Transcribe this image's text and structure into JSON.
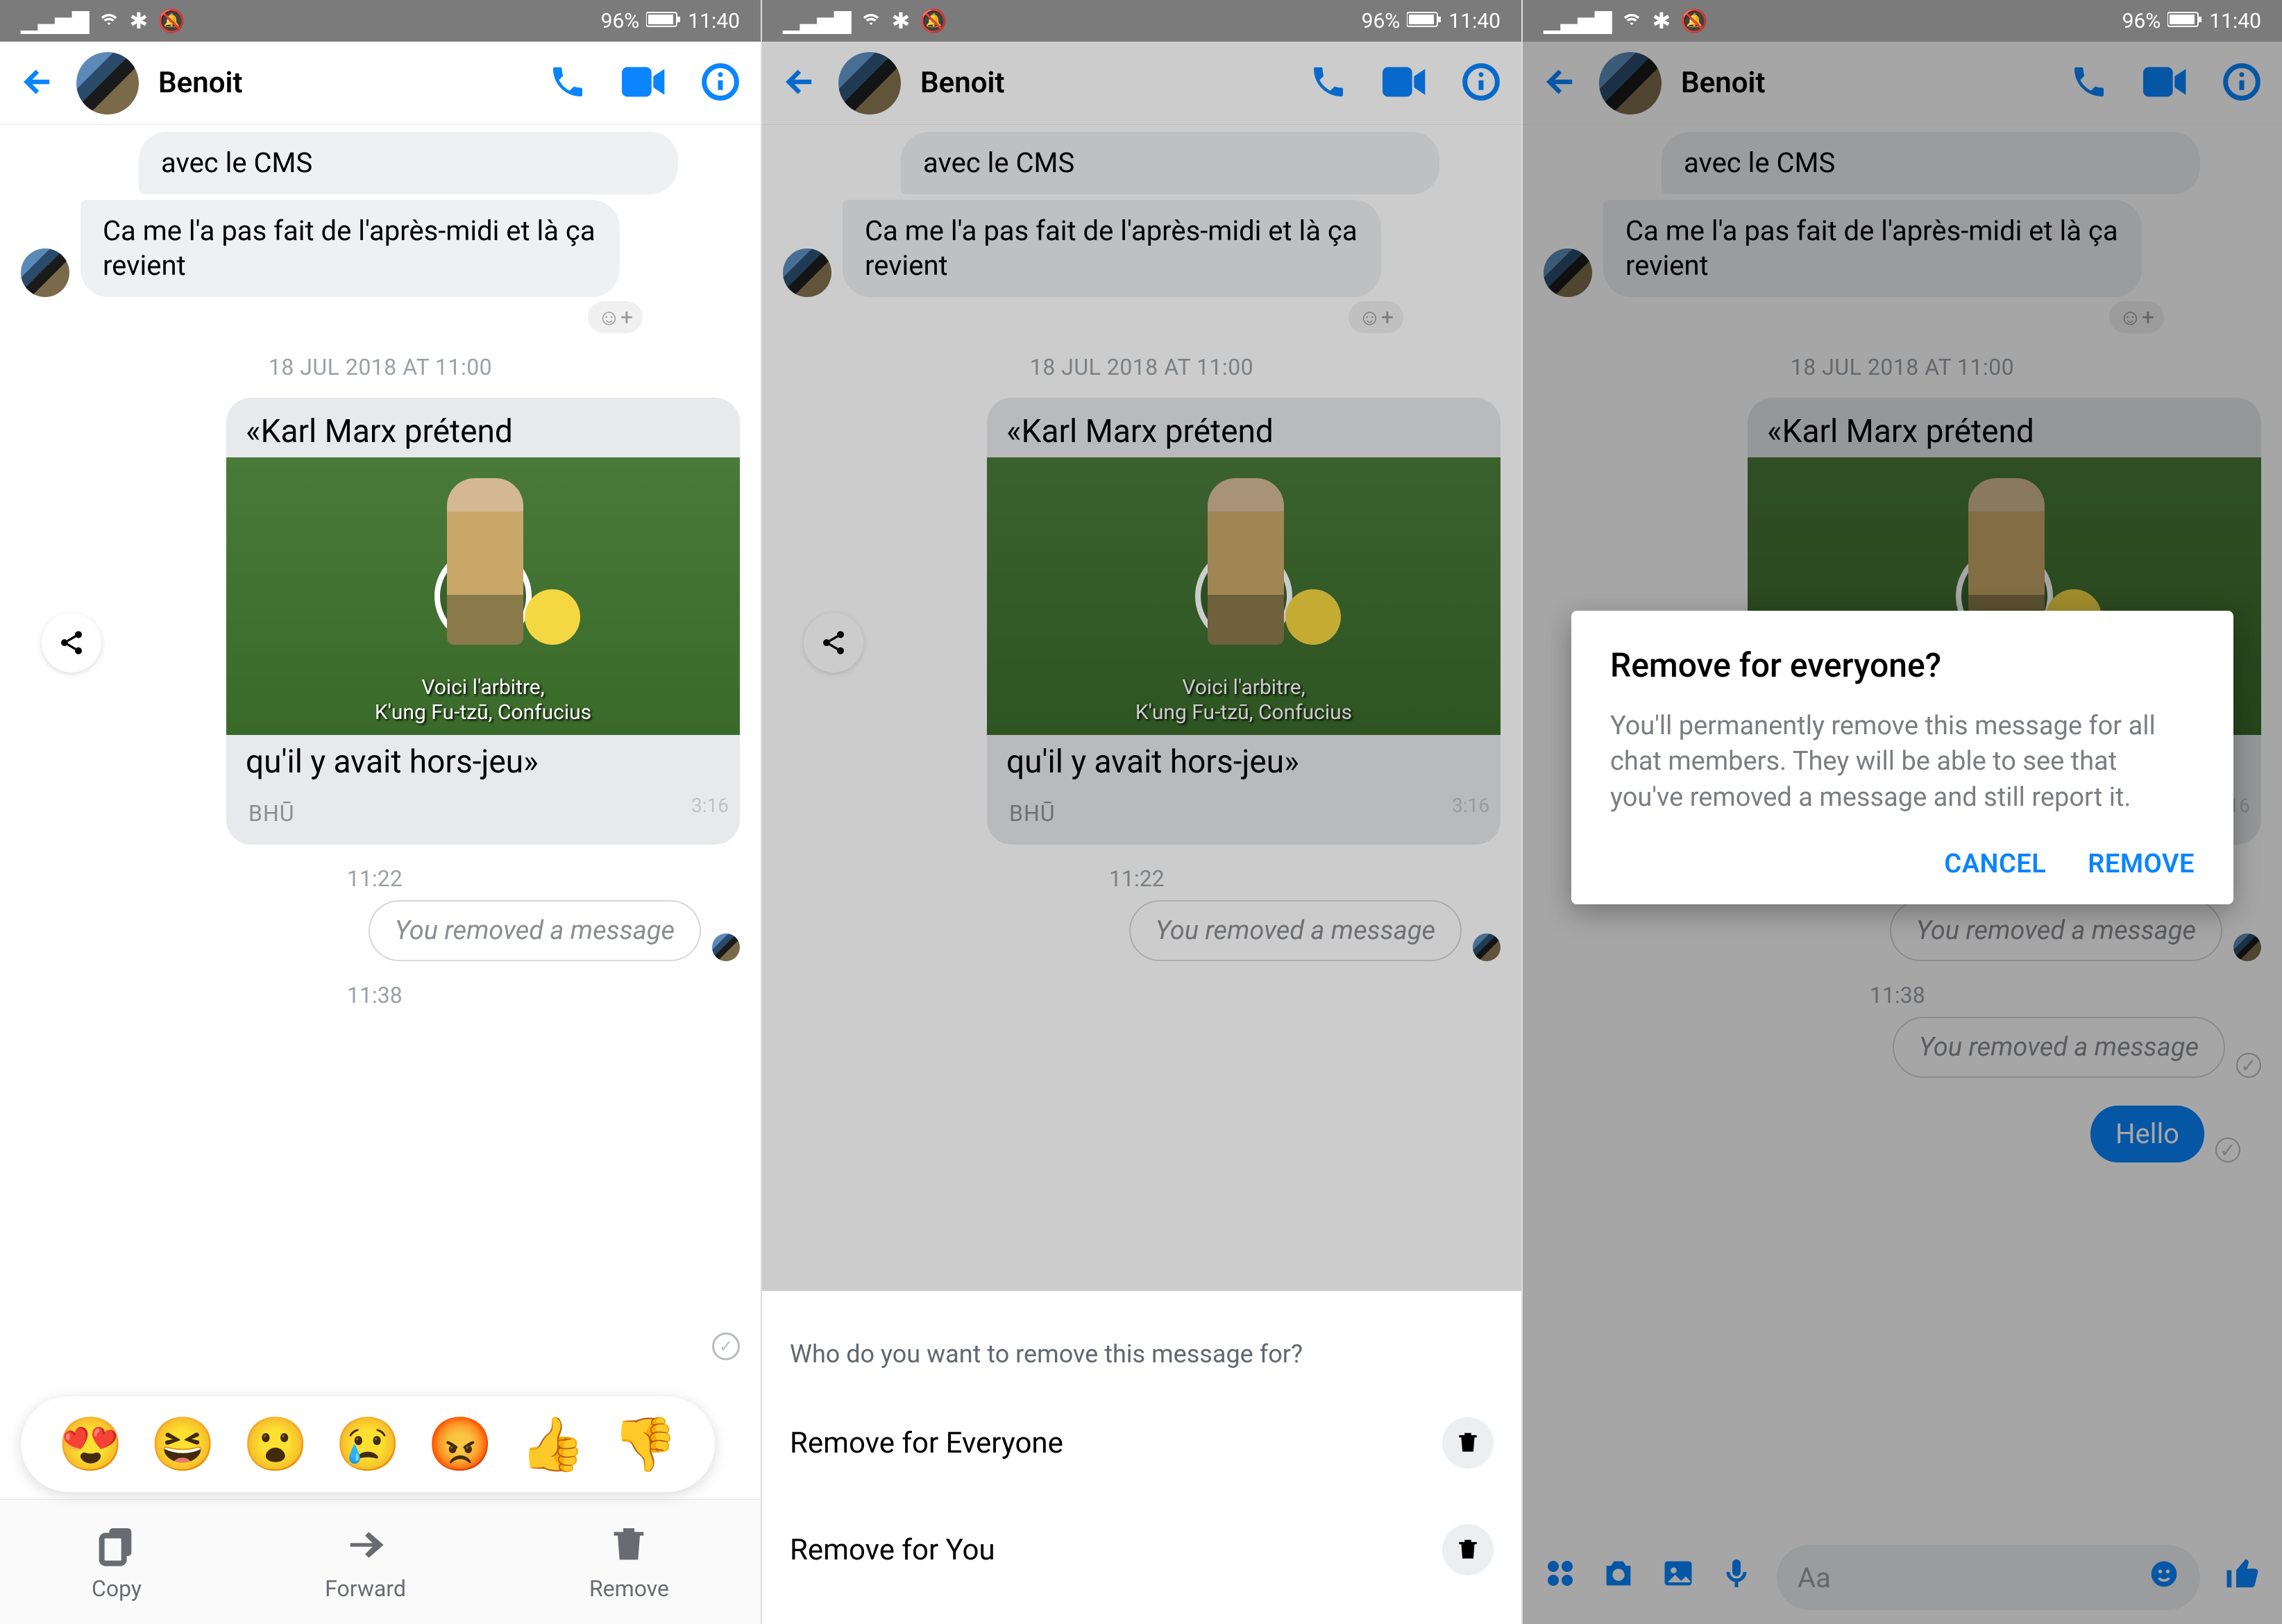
{
  "status": {
    "battery_pct": "96%",
    "time": "11:40"
  },
  "header": {
    "contact": "Benoit"
  },
  "chat": {
    "msg1": "avec le CMS",
    "msg2": "Ca me l'a pas fait de l'après-midi et là ça revient",
    "date_stamp": "18 JUL 2018 AT 11:00",
    "video": {
      "title": "«Karl Marx prétend",
      "subtitle_line1": "Voici l'arbitre,",
      "subtitle_line2": "K'ung Fu-tzū, Confucius",
      "caption": "qu'il y avait hors-jeu»",
      "duration": "3:16",
      "source": "BHŪ"
    },
    "time1": "11:22",
    "removed_text": "You removed a message",
    "time2": "11:38",
    "hello": "Hello"
  },
  "actions": {
    "copy": "Copy",
    "forward": "Forward",
    "remove": "Remove"
  },
  "sheet": {
    "question": "Who do you want to remove this message for?",
    "opt_everyone": "Remove for Everyone",
    "opt_you": "Remove for You"
  },
  "dialog": {
    "title": "Remove for everyone?",
    "body": "You'll permanently remove this message for all chat members. They will be able to see that you've removed a message and still report it.",
    "cancel": "CANCEL",
    "remove": "REMOVE"
  },
  "composer": {
    "placeholder": "Aa"
  },
  "reactions": {
    "e1": "😍",
    "e2": "😆",
    "e3": "😮",
    "e4": "😢",
    "e5": "😡",
    "e6": "👍",
    "e7": "👎"
  }
}
